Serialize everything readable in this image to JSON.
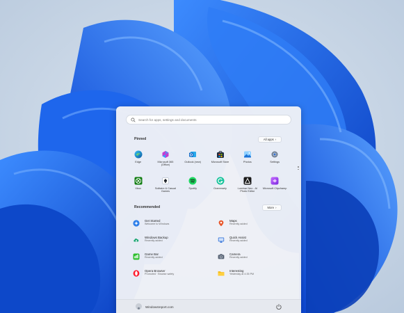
{
  "search": {
    "placeholder": "Search for apps, settings and documents"
  },
  "pinned": {
    "title": "Pinned",
    "all_apps_label": "All apps",
    "apps": [
      {
        "label": "Edge",
        "icon": "edge-icon"
      },
      {
        "label": "Microsoft 365 (Office)",
        "icon": "office-icon"
      },
      {
        "label": "Outlook (new)",
        "icon": "outlook-icon"
      },
      {
        "label": "Microsoft Store",
        "icon": "store-icon"
      },
      {
        "label": "Photos",
        "icon": "photos-icon"
      },
      {
        "label": "Settings",
        "icon": "settings-icon"
      },
      {
        "label": "Xbox",
        "icon": "xbox-icon"
      },
      {
        "label": "Solitaire & Casual Games",
        "icon": "solitaire-icon"
      },
      {
        "label": "Spotify",
        "icon": "spotify-icon"
      },
      {
        "label": "Grammarly",
        "icon": "grammarly-icon"
      },
      {
        "label": "Luminar Neo - AI Photo Editor",
        "icon": "luminar-icon"
      },
      {
        "label": "Microsoft Clipchamp",
        "icon": "clipchamp-icon"
      }
    ]
  },
  "recommended": {
    "title": "Recommended",
    "more_label": "More",
    "items": [
      {
        "title": "Get Started",
        "subtitle": "Welcome to Windows",
        "icon": "get-started-icon"
      },
      {
        "title": "Maps",
        "subtitle": "Recently added",
        "icon": "maps-icon"
      },
      {
        "title": "Windows Backup",
        "subtitle": "Recently added",
        "icon": "backup-icon"
      },
      {
        "title": "Quick Assist",
        "subtitle": "Recently added",
        "icon": "quick-assist-icon"
      },
      {
        "title": "Game Bar",
        "subtitle": "Recently added",
        "icon": "game-bar-icon"
      },
      {
        "title": "Camera",
        "subtitle": "Recently added",
        "icon": "camera-icon"
      },
      {
        "title": "Opera Browser",
        "subtitle": "Promoted · Browse safely",
        "icon": "opera-icon"
      },
      {
        "title": "Interesting",
        "subtitle": "Yesterday at 4:35 PM",
        "icon": "folder-icon"
      }
    ]
  },
  "footer": {
    "user": "Windowsreport.com"
  },
  "colors": {
    "accent": "#0067c0",
    "wallpaper_blue": "#1a5fe0",
    "wallpaper_bg": "#c5d4e6"
  }
}
